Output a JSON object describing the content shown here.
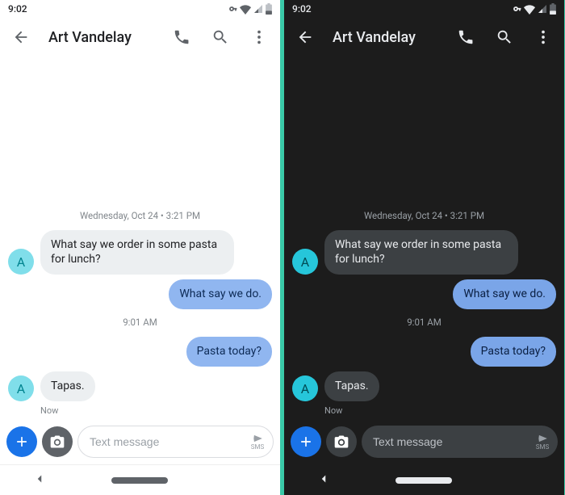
{
  "status": {
    "time": "9:02"
  },
  "header": {
    "contact_name": "Art Vandelay"
  },
  "timestamps": {
    "t1": "Wednesday, Oct 24 • 3:21 PM",
    "t2": "9:01 AM"
  },
  "messages": {
    "m1": {
      "text": "What say we order in some pasta for lunch?",
      "avatar": "A"
    },
    "m2": {
      "text": "What say we do."
    },
    "m3": {
      "text": "Pasta today?"
    },
    "m4": {
      "text": "Tapas.",
      "avatar": "A",
      "meta": "Now"
    }
  },
  "composer": {
    "placeholder": "Text message",
    "send_label": "SMS"
  }
}
